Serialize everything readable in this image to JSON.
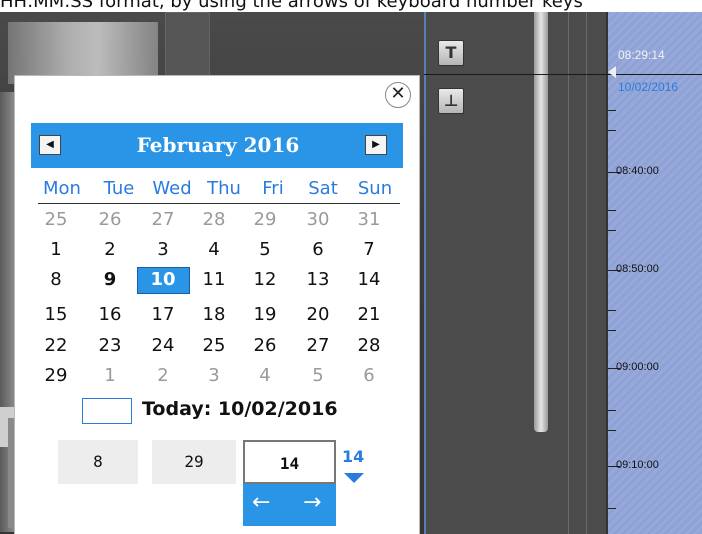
{
  "instruction_text": "HH:MM:SS format, by using the arrows of keyboard number keys",
  "timeline": {
    "current_time": "08:29:14",
    "current_date": "10/02/2016",
    "labels": [
      "08:40:00",
      "08:50:00",
      "09:00:00",
      "09:10:00"
    ]
  },
  "toolbar": {
    "top_button_glyph": "T",
    "bottom_button_glyph": "⊥"
  },
  "calendar": {
    "close_glyph": "✕",
    "prev_glyph": "◀",
    "next_glyph": "▶",
    "month_title": "February 2016",
    "days_of_week": [
      "Mon",
      "Tue",
      "Wed",
      "Thu",
      "Fri",
      "Sat",
      "Sun"
    ],
    "weeks": [
      [
        "25",
        "26",
        "27",
        "28",
        "29",
        "30",
        "31"
      ],
      [
        "1",
        "2",
        "3",
        "4",
        "5",
        "6",
        "7"
      ],
      [
        "8",
        "9",
        "10",
        "11",
        "12",
        "13",
        "14"
      ],
      [
        "15",
        "16",
        "17",
        "18",
        "19",
        "20",
        "21"
      ],
      [
        "22",
        "23",
        "24",
        "25",
        "26",
        "27",
        "28"
      ],
      [
        "29",
        "1",
        "2",
        "3",
        "4",
        "5",
        "6"
      ]
    ],
    "today_label": "Today: 10/02/2016"
  },
  "time_picker": {
    "hours": "8",
    "minutes": "29",
    "seconds": "14",
    "step_value": "14",
    "left_arrow": "←",
    "right_arrow": "→"
  },
  "colors": {
    "accent": "#2a95e6",
    "link": "#2a7be0"
  }
}
